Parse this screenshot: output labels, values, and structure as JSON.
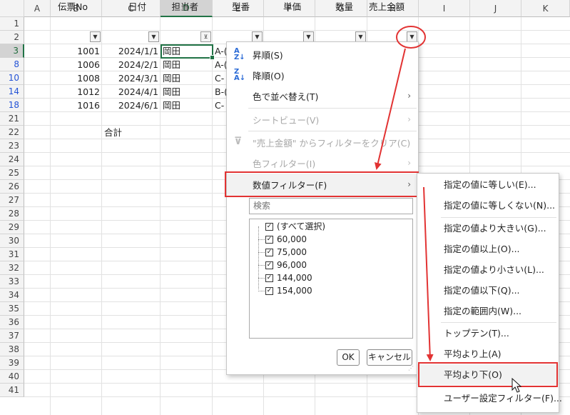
{
  "columns": [
    "A",
    "B",
    "C",
    "D",
    "E",
    "F",
    "G",
    "H",
    "I",
    "J",
    "K"
  ],
  "rows": [
    "1",
    "2",
    "3",
    "8",
    "10",
    "14",
    "18",
    "21",
    "22",
    "23",
    "24",
    "25",
    "26",
    "27",
    "28",
    "29",
    "30",
    "31",
    "32",
    "33",
    "34",
    "35",
    "36",
    "37",
    "38",
    "39",
    "40",
    "41"
  ],
  "headers": {
    "b": "伝票No",
    "c": "日付",
    "d": "担当者",
    "e": "型番",
    "f": "単価",
    "g": "数量",
    "h": "売上金額"
  },
  "data_rows": [
    {
      "no": "1001",
      "date": "2024/1/1",
      "person": "岡田",
      "model": "A-("
    },
    {
      "no": "1006",
      "date": "2024/2/1",
      "person": "岡田",
      "model": "A-("
    },
    {
      "no": "1008",
      "date": "2024/3/1",
      "person": "岡田",
      "model": "C-"
    },
    {
      "no": "1012",
      "date": "2024/4/1",
      "person": "岡田",
      "model": "B-("
    },
    {
      "no": "1016",
      "date": "2024/6/1",
      "person": "岡田",
      "model": "C-"
    }
  ],
  "total_label": "合計",
  "dropdown": {
    "sort_asc": "昇順(S)",
    "sort_desc": "降順(O)",
    "sort_by_color": "色で並べ替え(T)",
    "sheet_view": "シートビュー(V)",
    "clear_filter": "\"売上金額\" からフィルターをクリア(C)",
    "color_filter": "色フィルター(I)",
    "number_filter": "数値フィルター(F)",
    "search_placeholder": "検索",
    "list_items": [
      "(すべて選択)",
      "60,000",
      "75,000",
      "96,000",
      "144,000",
      "154,000"
    ],
    "ok": "OK",
    "cancel": "キャンセル"
  },
  "submenu": [
    "指定の値に等しい(E)...",
    "指定の値に等しくない(N)...",
    "指定の値より大きい(G)...",
    "指定の値以上(O)...",
    "指定の値より小さい(L)...",
    "指定の値以下(Q)...",
    "指定の範囲内(W)...",
    "トップテン(T)...",
    "平均より上(A)",
    "平均より下(O)",
    "ユーザー設定フィルター(F)..."
  ],
  "colors": {
    "accent": "#217346",
    "annotation": "#e23333",
    "filtered_row_number": "#2453d6"
  },
  "icons": [
    "sort-asc-icon",
    "sort-desc-icon",
    "clear-filter-icon",
    "filter-dropdown-icon",
    "filter-active-icon",
    "chevron-right-icon",
    "checkbox-checked-icon",
    "mouse-cursor-icon"
  ]
}
